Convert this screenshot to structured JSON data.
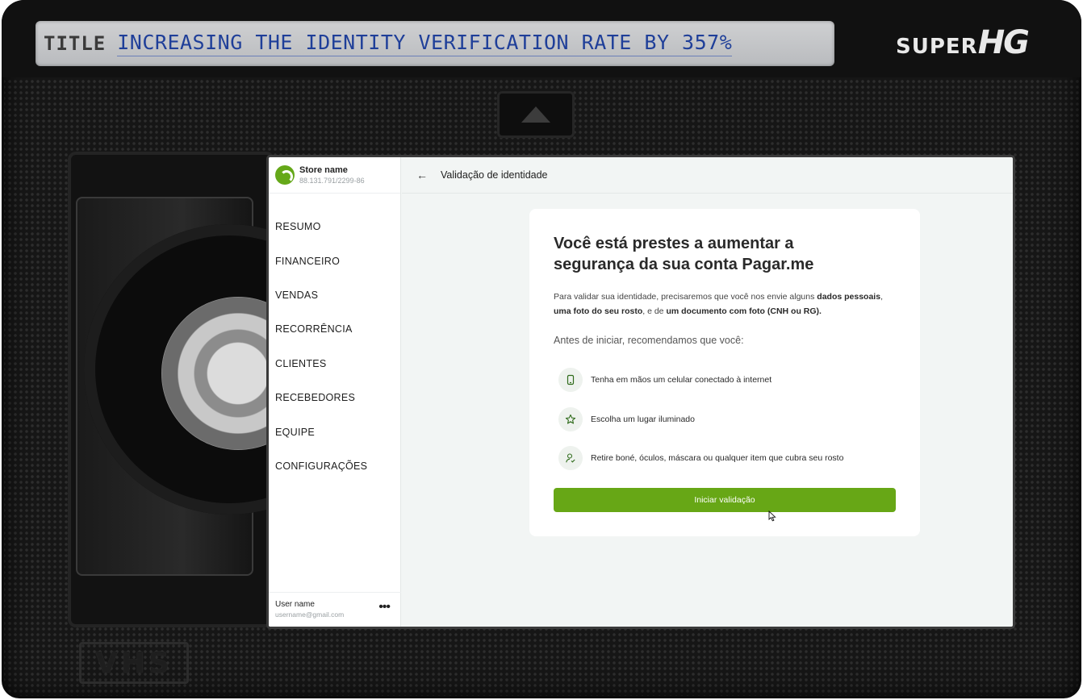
{
  "cassette": {
    "label_prefix": "TITLE",
    "label_text": "INCREASING THE IDENTITY VERIFICATION RATE BY 357%",
    "brand_super": "SUPER",
    "brand_hg": "HG",
    "format_logo": "VHS"
  },
  "sidebar": {
    "store_name": "Store name",
    "store_id": "88.131.791/2299-86",
    "items": [
      {
        "label": "RESUMO"
      },
      {
        "label": "FINANCEIRO"
      },
      {
        "label": "VENDAS"
      },
      {
        "label": "RECORRÊNCIA"
      },
      {
        "label": "CLIENTES"
      },
      {
        "label": "RECEBEDORES"
      },
      {
        "label": "EQUIPE"
      },
      {
        "label": "CONFIGURAÇÕES"
      }
    ],
    "user_name": "User name",
    "user_email": "username@gmail.com"
  },
  "header": {
    "title": "Validação de identidade"
  },
  "card": {
    "title_line1": "Você está prestes a aumentar a",
    "title_line2": "segurança da sua conta Pagar.me",
    "desc_part1": "Para validar sua identidade, precisaremos que você nos envie alguns ",
    "desc_bold1": "dados pessoais",
    "desc_part2": ", ",
    "desc_bold2": "uma foto do seu rosto",
    "desc_part3": ", e de ",
    "desc_bold3": "um documento com foto (CNH ou RG).",
    "subtitle": "Antes de iniciar, recomendamos que você:",
    "tips": [
      {
        "icon": "smartphone-icon",
        "text": "Tenha em mãos um celular conectado à internet"
      },
      {
        "icon": "star-icon",
        "text": "Escolha um lugar iluminado"
      },
      {
        "icon": "user-check-icon",
        "text": "Retire boné, óculos, máscara ou qualquer item que cubra seu rosto"
      }
    ],
    "button_label": "Iniciar validação"
  },
  "colors": {
    "accent": "#67a716",
    "screen_bg": "#f2f5f4",
    "cassette_body": "#161616",
    "label_ink": "#1f3f99"
  }
}
